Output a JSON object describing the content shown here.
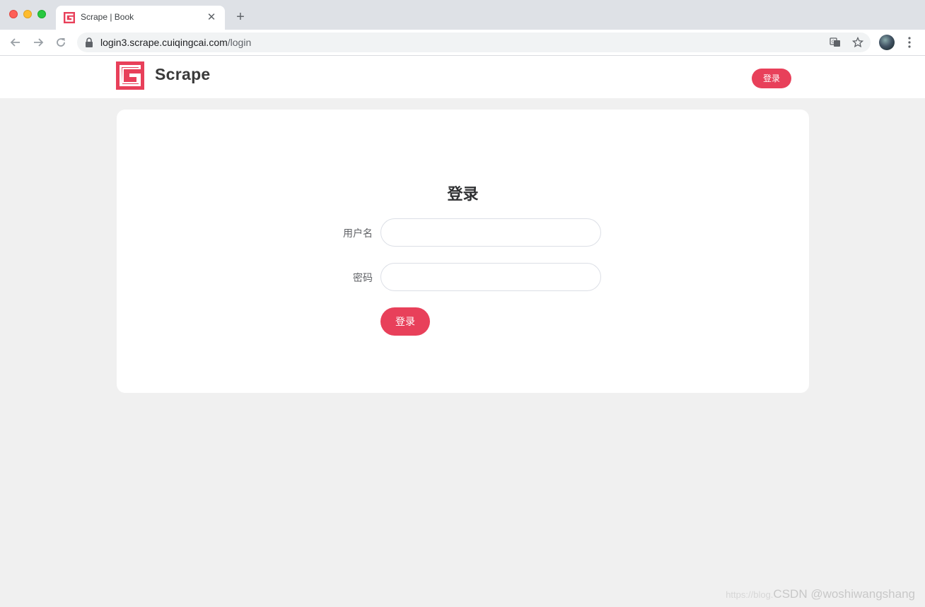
{
  "browser": {
    "tab_title": "Scrape | Book",
    "url_host": "login3.scrape.cuiqingcai.com",
    "url_path": "/login"
  },
  "site": {
    "brand": "Scrape",
    "header_login": "登录",
    "brand_color": "#e8405a"
  },
  "form": {
    "title": "登录",
    "username_label": "用户名",
    "username_value": "",
    "password_label": "密码",
    "password_value": "",
    "submit_label": "登录"
  },
  "watermark": {
    "prefix": "https://blog.",
    "text": "CSDN @woshiwangshang"
  }
}
